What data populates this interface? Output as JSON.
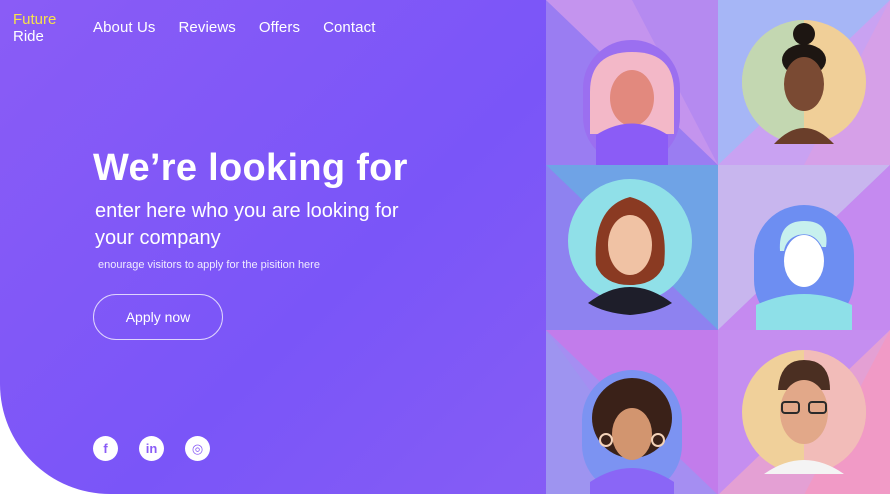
{
  "brand": {
    "line1": "Future",
    "line2": "Ride"
  },
  "nav": [
    {
      "label": "About Us"
    },
    {
      "label": "Reviews"
    },
    {
      "label": "Offers"
    },
    {
      "label": "Contact"
    }
  ],
  "hero": {
    "headline": "We’re looking for",
    "subheadline": "enter here who you are looking for your company",
    "tagline": "enourage visitors to apply for the pisition here",
    "cta": "Apply now"
  },
  "socials": [
    {
      "icon": "facebook-icon",
      "glyph": "f"
    },
    {
      "icon": "linkedin-icon",
      "glyph": "in"
    },
    {
      "icon": "instagram-icon",
      "glyph": "◎"
    }
  ],
  "colors": {
    "primary": "#8a5cf6",
    "brand_accent": "#f6e24b",
    "text": "#ffffff"
  },
  "team_tiles": [
    {
      "icon": "avatar-placeholder-icon"
    },
    {
      "icon": "photo-woman-buns-icon"
    },
    {
      "icon": "photo-woman-red-hair-icon"
    },
    {
      "icon": "avatar-placeholder-icon"
    },
    {
      "icon": "avatar-placeholder-icon"
    },
    {
      "icon": "photo-man-glasses-icon"
    }
  ]
}
